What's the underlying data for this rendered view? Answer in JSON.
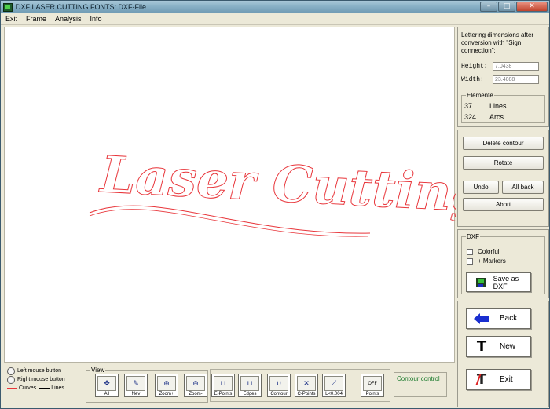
{
  "window": {
    "title": "DXF LASER CUTTING FONTS:  DXF-File",
    "controls": {
      "minimize": "–",
      "maximize": "□",
      "close": "✕"
    }
  },
  "menu": [
    "Exit",
    "Frame",
    "Analysis",
    "Info"
  ],
  "canvas": {
    "preview_text": "Laser Cutting",
    "stroke_color": "#e8353a"
  },
  "info_panel": {
    "note": "Lettering dimensions after conversion with \"Sign connection\":",
    "height_label": "Height:",
    "height_value": "7.0438",
    "width_label": "Width:",
    "width_value": "23.4088"
  },
  "elements": {
    "legend": "Elemente",
    "rows": [
      {
        "count": "37",
        "label": "Lines"
      },
      {
        "count": "324",
        "label": "Arcs"
      }
    ]
  },
  "edit_buttons": {
    "delete": "Delete contour",
    "rotate": "Rotate",
    "undo": "Undo",
    "all_back": "All back",
    "abort": "Abort"
  },
  "dxf": {
    "legend": "DXF",
    "colorful": "Colorful",
    "markers": "+ Markers",
    "save": "Save as DXF"
  },
  "nav": {
    "back": "Back",
    "new": "New",
    "exit": "Exit"
  },
  "legend": {
    "left_mouse": "Left mouse button",
    "right_mouse": "Right mouse button",
    "curves": "Curves",
    "lines": "Lines"
  },
  "view": {
    "label": "View",
    "tools": [
      {
        "label": "All",
        "icon": "move-arrows-icon",
        "glyph": "✥"
      },
      {
        "label": "Nev",
        "icon": "pencil-icon",
        "glyph": "✎"
      },
      {
        "label": "Zoom+",
        "icon": "zoom-in-icon",
        "glyph": "⊕"
      },
      {
        "label": "Zoom-",
        "icon": "zoom-out-icon",
        "glyph": "⊖"
      }
    ]
  },
  "contour_tools": [
    {
      "label": "E-Points",
      "icon": "end-points-icon",
      "glyph": "⊔"
    },
    {
      "label": "Edges",
      "icon": "edges-icon",
      "glyph": "⊔"
    },
    {
      "label": "Contour",
      "icon": "contour-icon",
      "glyph": "∪"
    },
    {
      "label": "C-Points",
      "icon": "cross-points-icon",
      "glyph": "✕"
    },
    {
      "label": "L<0.004",
      "icon": "short-line-icon",
      "glyph": "⟋"
    },
    {
      "label": "Points",
      "icon": "points-toggle-icon",
      "glyph": "OFF"
    }
  ],
  "contour_control": "Contour control"
}
